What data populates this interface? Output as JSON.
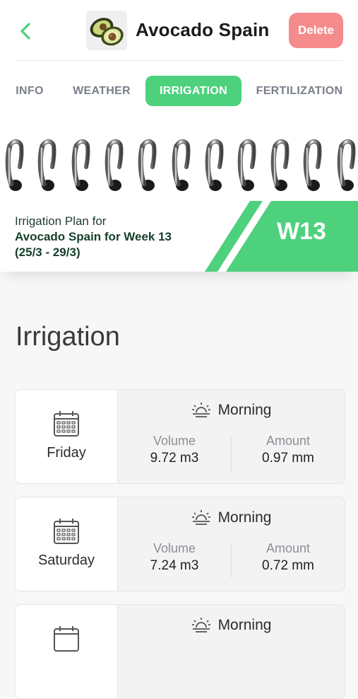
{
  "header": {
    "title": "Avocado Spain",
    "delete_label": "Delete"
  },
  "tabs": [
    {
      "label": "INFO",
      "active": false
    },
    {
      "label": "WEATHER",
      "active": false
    },
    {
      "label": "IRRIGATION",
      "active": true
    },
    {
      "label": "FERTILIZATION",
      "active": false
    }
  ],
  "plan": {
    "line1": "Irrigation Plan for",
    "line2": "Avocado Spain for Week 13",
    "line3": "(25/3 - 29/3)",
    "week": "W13"
  },
  "section_title": "Irrigation",
  "entries": [
    {
      "day": "Friday",
      "period": "Morning",
      "volume_label": "Volume",
      "volume": "9.72 m3",
      "amount_label": "Amount",
      "amount": "0.97 mm"
    },
    {
      "day": "Saturday",
      "period": "Morning",
      "volume_label": "Volume",
      "volume": "7.24 m3",
      "amount_label": "Amount",
      "amount": "0.72 mm"
    },
    {
      "day": "",
      "period": "Morning",
      "volume_label": "",
      "volume": "",
      "amount_label": "",
      "amount": ""
    }
  ],
  "colors": {
    "accent": "#4dd17d",
    "delete": "#f58b8c",
    "dark_green": "#163f2b"
  }
}
